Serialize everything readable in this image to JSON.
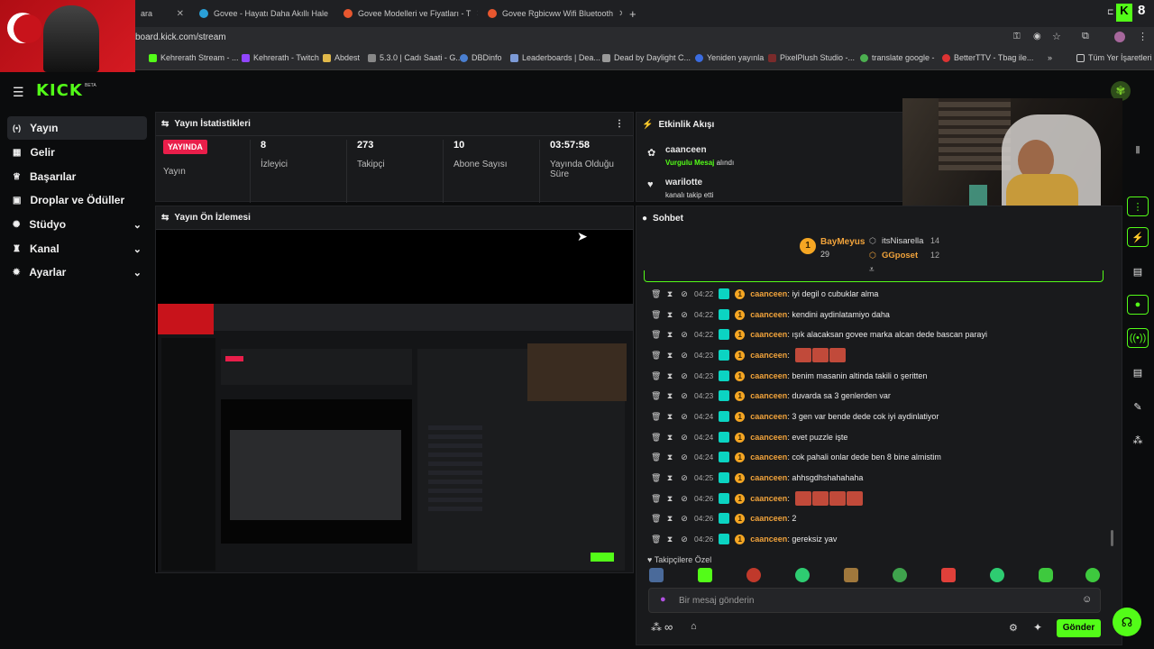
{
  "browser": {
    "tabs": [
      {
        "label": "ara",
        "color": "#53fc18"
      },
      {
        "label": "Govee - Hayatı Daha Akıllı Hale",
        "color": "#2aa0d8"
      },
      {
        "label": "Govee Modelleri ve Fiyatları - T",
        "color": "#e8572f"
      },
      {
        "label": "Govee Rgbicww Wifi Bluetooth",
        "color": "#e8572f"
      }
    ],
    "url": "board.kick.com/stream",
    "bookmarks": [
      {
        "label": "Kehrerath Stream - ...",
        "color": "#53fc18"
      },
      {
        "label": "Kehrerath - Twitch",
        "color": "#9146ff"
      },
      {
        "label": "Abdest",
        "color": "#e0b84a"
      },
      {
        "label": "5.3.0 | Cadı Saati - G...",
        "color": "#888888"
      },
      {
        "label": "DBDinfo",
        "color": "#4a7fd0"
      },
      {
        "label": "Leaderboards | Dea...",
        "color": "#7c9ad6"
      },
      {
        "label": "Dead by Daylight C...",
        "color": "#999999"
      },
      {
        "label": "Yeniden yayınla",
        "color": "#3b6ce0"
      },
      {
        "label": "PixelPlush Studio -...",
        "color": "#7a2b2b"
      },
      {
        "label": "translate google -",
        "color": "#4caf50"
      },
      {
        "label": "BetterTTV - Tbag ile...",
        "color": "#d33"
      }
    ],
    "all_bookmarks": "Tüm Yer İşaretleri"
  },
  "nav": {
    "logo": "KICK",
    "beta": "BETA"
  },
  "sidebar": {
    "items": [
      {
        "label": "Yayın",
        "icon": "broadcast-icon",
        "glyph": "(•)",
        "active": true
      },
      {
        "label": "Gelir",
        "icon": "revenue-icon",
        "glyph": "▦"
      },
      {
        "label": "Başarılar",
        "icon": "trophy-icon",
        "glyph": "♕"
      },
      {
        "label": "Droplar ve Ödüller",
        "icon": "gift-icon",
        "glyph": "▣"
      },
      {
        "label": "Stüdyo",
        "icon": "studio-icon",
        "glyph": "✺",
        "expandable": true
      },
      {
        "label": "Kanal",
        "icon": "channel-icon",
        "glyph": "♜",
        "expandable": true
      },
      {
        "label": "Ayarlar",
        "icon": "settings-icon",
        "glyph": "✹",
        "expandable": true
      }
    ]
  },
  "stats": {
    "title": "Yayın İstatistikleri",
    "live_badge": "YAYINDA",
    "live_label": "Yayın",
    "viewers": {
      "value": "8",
      "label": "İzleyici"
    },
    "followers": {
      "value": "273",
      "label": "Takipçi"
    },
    "subs": {
      "value": "10",
      "label": "Abone Sayısı"
    },
    "uptime": {
      "value": "03:57:58",
      "label": "Yayında Olduğu Süre"
    }
  },
  "activity": {
    "title": "Etkinlik Akışı",
    "events": [
      {
        "user": "caanceen",
        "highlight": "Vurgulu Mesaj",
        "text": "alındı"
      },
      {
        "user": "warilotte",
        "text": "kanalı takip etti"
      }
    ]
  },
  "preview": {
    "title": "Yayın Ön İzlemesi"
  },
  "chat": {
    "title": "Sohbet",
    "leaders": [
      {
        "rank": "1",
        "name": "BayMeyus",
        "count": "29"
      },
      {
        "name": "itsNisarella",
        "count": "14"
      },
      {
        "name": "GGposet",
        "count": "12"
      }
    ],
    "messages": [
      {
        "time": "04:22",
        "user": "caanceen",
        "text": ": iyi degil o cubuklar alma"
      },
      {
        "time": "04:22",
        "user": "caanceen",
        "text": ": kendini aydinlatamiyo daha"
      },
      {
        "time": "04:22",
        "user": "caanceen",
        "text": ": ışık alacaksan govee marka alcan dede bascan parayi"
      },
      {
        "time": "04:23",
        "user": "caanceen",
        "text": ":",
        "emotes": 3
      },
      {
        "time": "04:23",
        "user": "caanceen",
        "text": ": benim masanin altinda takili o şeritten"
      },
      {
        "time": "04:23",
        "user": "caanceen",
        "text": ": duvarda sa 3 genlerden var"
      },
      {
        "time": "04:24",
        "user": "caanceen",
        "text": ": 3 gen var bende dede cok iyi aydinlatiyor"
      },
      {
        "time": "04:24",
        "user": "caanceen",
        "text": ": evet puzzle işte"
      },
      {
        "time": "04:24",
        "user": "caanceen",
        "text": ": cok pahali onlar dede ben 8 bine almistim"
      },
      {
        "time": "04:25",
        "user": "caanceen",
        "text": ": ahhsgdhshahahaha"
      },
      {
        "time": "04:26",
        "user": "caanceen",
        "text": ":",
        "emotes": 4
      },
      {
        "time": "04:26",
        "user": "caanceen",
        "text": ": 2"
      },
      {
        "time": "04:26",
        "user": "caanceen",
        "text": ": gereksiz yav"
      }
    ],
    "follower_only": "Takipçilere Özel",
    "input_placeholder": "Bir mesaj gönderin",
    "send_label": "Gönder"
  },
  "colors": {
    "accent": "#53fc18",
    "live": "#e91e4a",
    "username": "#f1a33b"
  }
}
